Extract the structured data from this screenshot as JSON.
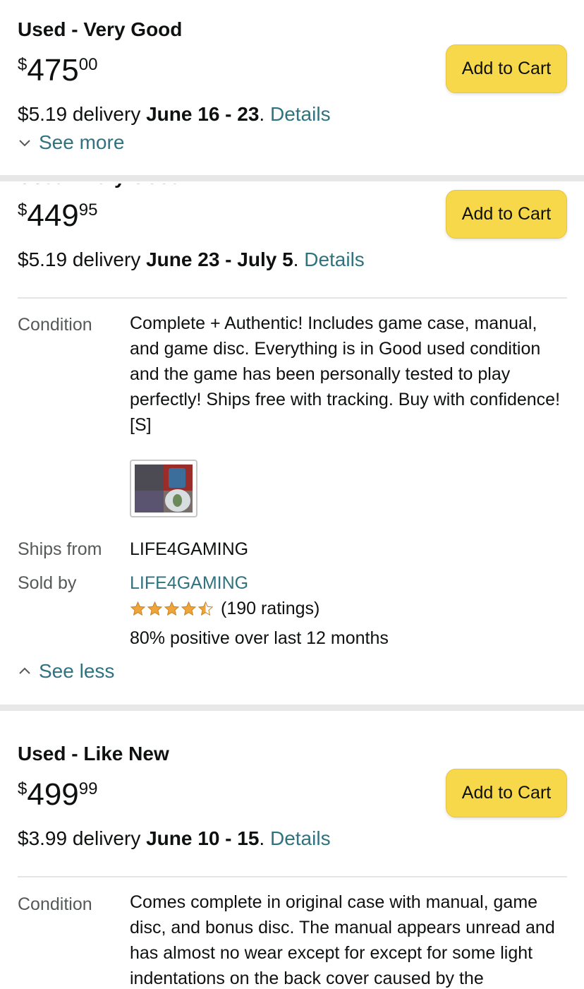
{
  "offers": [
    {
      "condition": "Used - Very Good",
      "price_symbol": "$",
      "price_whole": "475",
      "price_fraction": "00",
      "cart_label": "Add to Cart",
      "delivery_cost": "$5.19 delivery ",
      "delivery_dates": "June 16 - 23",
      "delivery_sep": ". ",
      "details_label": "Details",
      "toggle_label": "See more"
    },
    {
      "condition": "Used - Very Good",
      "price_symbol": "$",
      "price_whole": "449",
      "price_fraction": "95",
      "cart_label": "Add to Cart",
      "delivery_cost": "$5.19 delivery ",
      "delivery_dates": "June 23 - July 5",
      "delivery_sep": ". ",
      "details_label": "Details",
      "condition_label": "Condition",
      "condition_text": "Complete + Authentic! Includes game case, manual, and game disc. Everything is in Good used condition and the game has been personally tested to play perfectly! Ships free with tracking. Buy with confidence! [S]",
      "ships_from_label": "Ships from",
      "ships_from_value": "LIFE4GAMING",
      "sold_by_label": "Sold by",
      "sold_by_value": "LIFE4GAMING",
      "rating_stars": 4.5,
      "ratings_count": "(190 ratings)",
      "positive_text": "80% positive over last 12 months",
      "toggle_label": "See less"
    },
    {
      "condition": "Used - Like New",
      "price_symbol": "$",
      "price_whole": "499",
      "price_fraction": "99",
      "cart_label": "Add to Cart",
      "delivery_cost": "$3.99 delivery ",
      "delivery_dates": "June 10 - 15",
      "delivery_sep": ". ",
      "details_label": "Details",
      "condition_label": "Condition",
      "condition_text": "Comes complete in original case with manual, game disc, and bonus disc. The manual appears unread and has almost no wear except for except for some light indentations on the back cover caused by the"
    }
  ],
  "colors": {
    "link": "#2f7380",
    "button": "#f7d84a",
    "star": "#f0a53b"
  }
}
